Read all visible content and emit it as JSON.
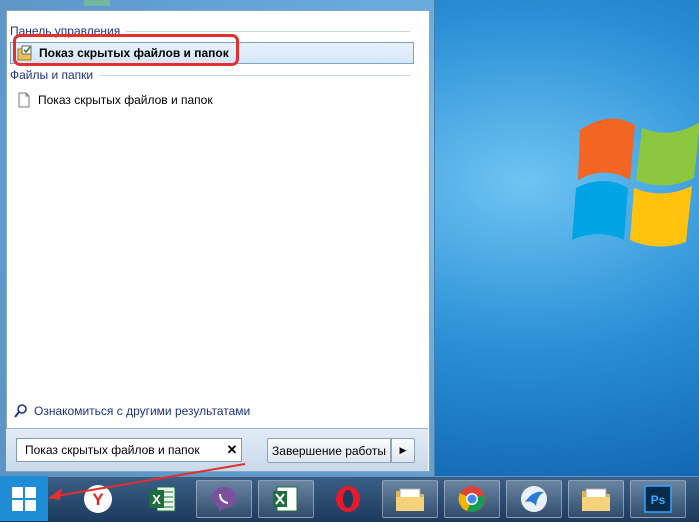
{
  "start_menu": {
    "control_panel_header": "Панель управления",
    "control_panel_result": "Показ скрытых файлов и папок",
    "files_header": "Файлы и папки",
    "files_result": "Показ скрытых файлов и папок",
    "see_more": "Ознакомиться с другими результатами",
    "search_value": "Показ скрытых файлов и папок",
    "clear_symbol": "✕",
    "shutdown_label": "Завершение работы",
    "shutdown_arrow": "▶"
  },
  "taskbar": {
    "icons": [
      "windows-start",
      "yandex-browser",
      "excel",
      "viber",
      "excel-file",
      "opera",
      "file-explorer",
      "chrome",
      "messenger",
      "file-explorer-2",
      "photoshop"
    ],
    "excel_letter": "X",
    "yandex_letter": "Y",
    "photoshop_label": "Ps"
  },
  "colors": {
    "header_text": "#1e3287",
    "highlight": "#e23030",
    "taskbar": "#1c3a5c"
  }
}
